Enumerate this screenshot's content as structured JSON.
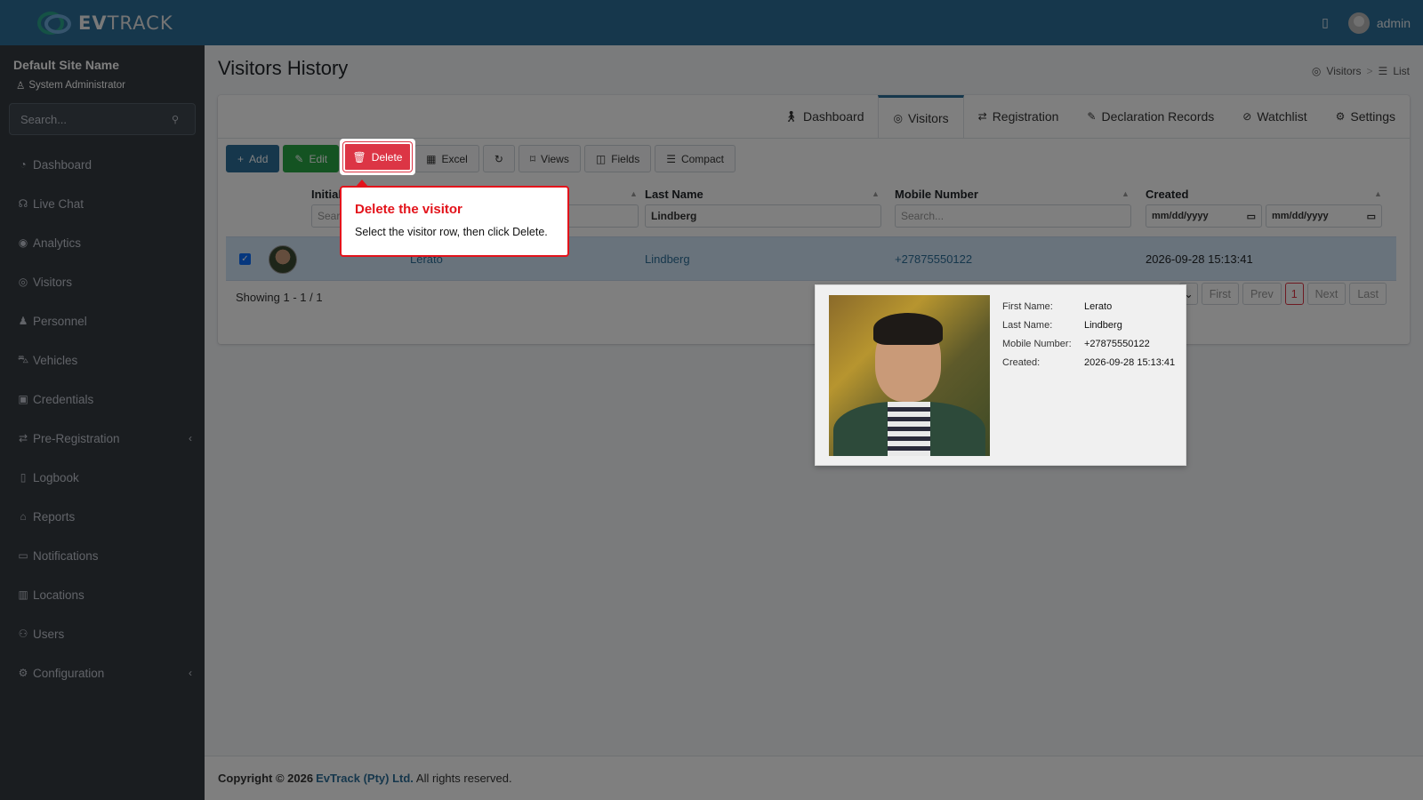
{
  "brand": {
    "name_bold": "EV",
    "name_rest": "TRACK"
  },
  "topbar": {
    "user": "admin",
    "book_icon": "book-icon",
    "avatar_icon": "user-avatar-icon"
  },
  "sidebar": {
    "site_name": "Default Site Name",
    "role": "System Administrator",
    "search_placeholder": "Search...",
    "items": [
      {
        "label": "Dashboard",
        "icon": "dashboard-icon",
        "glyph": "◔"
      },
      {
        "label": "Live Chat",
        "icon": "headset-icon",
        "glyph": "☊"
      },
      {
        "label": "Analytics",
        "icon": "analytics-icon",
        "glyph": "◉"
      },
      {
        "label": "Visitors",
        "icon": "eye-icon",
        "glyph": "◎"
      },
      {
        "label": "Personnel",
        "icon": "personnel-icon",
        "glyph": "♟"
      },
      {
        "label": "Vehicles",
        "icon": "car-icon",
        "glyph": "⛍"
      },
      {
        "label": "Credentials",
        "icon": "id-card-icon",
        "glyph": "▣"
      },
      {
        "label": "Pre-Registration",
        "icon": "exchange-icon",
        "glyph": "⇄",
        "expand": "‹"
      },
      {
        "label": "Logbook",
        "icon": "book-icon",
        "glyph": "▯"
      },
      {
        "label": "Reports",
        "icon": "reports-icon",
        "glyph": "⌂"
      },
      {
        "label": "Notifications",
        "icon": "notifications-icon",
        "glyph": "▭"
      },
      {
        "label": "Locations",
        "icon": "locations-icon",
        "glyph": "▥"
      },
      {
        "label": "Users",
        "icon": "users-icon",
        "glyph": "⚇"
      },
      {
        "label": "Configuration",
        "icon": "gear-icon",
        "glyph": "⚙",
        "expand": "‹"
      }
    ]
  },
  "page": {
    "title": "Visitors History",
    "breadcrumb": [
      "Visitors",
      "List"
    ]
  },
  "tabs": [
    {
      "label": "Dashboard",
      "glyph": "🚶︎"
    },
    {
      "label": "Visitors",
      "glyph": "◎",
      "active": true
    },
    {
      "label": "Registration",
      "glyph": "⇄"
    },
    {
      "label": "Declaration Records",
      "glyph": "✎"
    },
    {
      "label": "Watchlist",
      "glyph": "⊘"
    },
    {
      "label": "Settings",
      "glyph": "⚙"
    }
  ],
  "toolbar": {
    "add": "Add",
    "edit": "Edit",
    "delete": "Delete",
    "excel": "Excel",
    "views": "Views",
    "fields": "Fields",
    "compact": "Compact"
  },
  "table": {
    "columns": {
      "initials": "Initials",
      "last_name": "Last Name",
      "mobile": "Mobile Number",
      "created": "Created"
    },
    "filters": {
      "initials_placeholder": "Search...",
      "last_name_value": "Lindberg",
      "mobile_placeholder": "Search...",
      "date_from": "mm/dd/yyyy",
      "date_to": "mm/dd/yyyy"
    },
    "rows": [
      {
        "initials": "Lerato",
        "last_name": "Lindberg",
        "mobile": "+27875550122",
        "created": "2026-09-28 15:13:41",
        "selected": true
      }
    ],
    "showing": "Showing 1 - 1 / 1",
    "pager": {
      "first": "First",
      "prev": "Prev",
      "current": "1",
      "next": "Next",
      "last": "Last"
    }
  },
  "tooltip": {
    "title": "Delete the visitor",
    "body": "Select the visitor row, then click Delete."
  },
  "preview": {
    "labels": [
      "First Name:",
      "Last Name:",
      "Mobile Number:",
      "Created:"
    ],
    "values": [
      "Lerato",
      "Lindberg",
      "+27875550122",
      "2026-09-28 15:13:41"
    ]
  },
  "footer": {
    "prefix": "Copyright © 2026",
    "company": "EvTrack (Pty) Ltd.",
    "suffix": "All rights reserved."
  },
  "colors": {
    "primary": "#2c6e99",
    "danger": "#dc3545",
    "success": "#28a745",
    "sidebar": "#343a40",
    "highlight": "#e3131b"
  }
}
